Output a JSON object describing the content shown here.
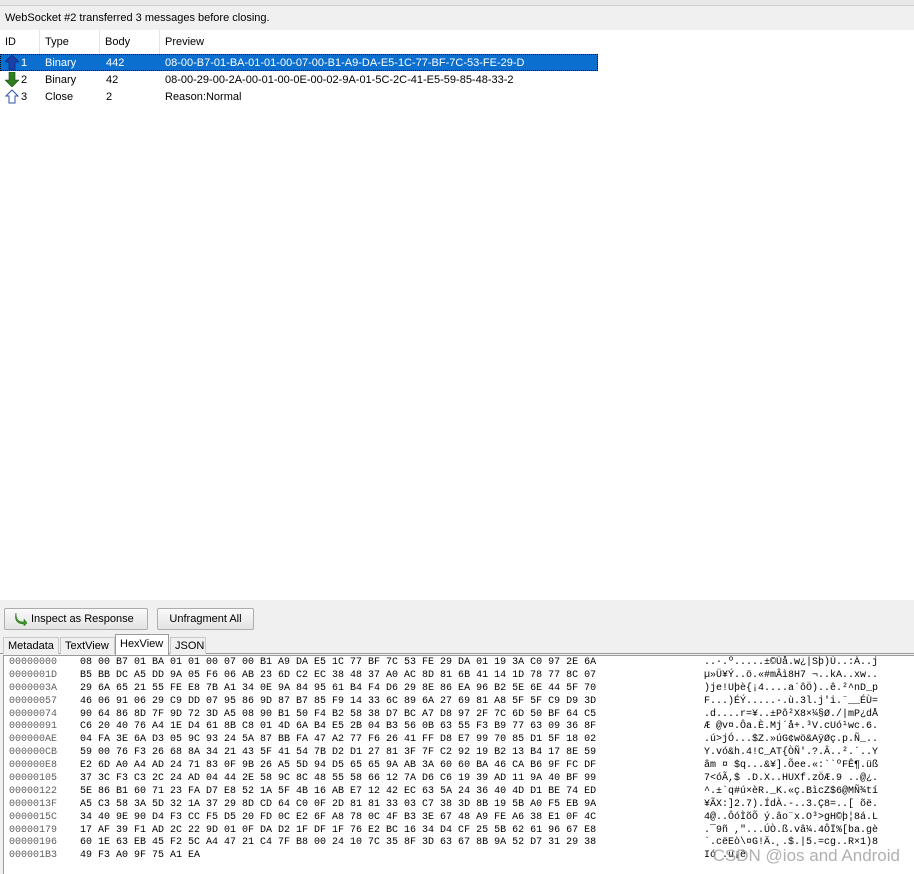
{
  "info_text": "WebSocket #2 transferred 3 messages before closing.",
  "columns": [
    "ID",
    "Type",
    "Body",
    "Preview"
  ],
  "messages": [
    {
      "id": "1",
      "type": "Binary",
      "body": "442",
      "preview": "08-00-B7-01-BA-01-01-00-07-00-B1-A9-DA-E5-1C-77-BF-7C-53-FE-29-D",
      "direction": "up-arrow-icon"
    },
    {
      "id": "2",
      "type": "Binary",
      "body": "42",
      "preview": "08-00-29-00-2A-00-01-00-0E-00-02-9A-01-5C-2C-41-E5-59-85-48-33-2",
      "direction": "down-arrow-icon"
    },
    {
      "id": "3",
      "type": "Close",
      "body": "2",
      "preview": "Reason:Normal",
      "direction": "close-arrow-icon"
    }
  ],
  "buttons": {
    "inspect": "Inspect as Response",
    "unfragment": "Unfragment All"
  },
  "tabs": [
    "Metadata",
    "TextView",
    "HexView",
    "JSON"
  ],
  "active_tab": "HexView",
  "hex_rows": [
    {
      "offset": "00000000",
      "bytes": "08 00 B7 01 BA 01 01 00 07 00 B1 A9 DA E5 1C 77 BF 7C 53 FE 29 DA 01 19 3A C0 97 2E 6A",
      "ascii": "..·.º.....±©Úå.w¿|Sþ)Ú..:À..j"
    },
    {
      "offset": "0000001D",
      "bytes": "B5 BB DC A5 DD 9A 05 F6 06 AB 23 6D C2 EC 38 48 37 A0 AC 8D 81 6B 41 14 1D 78 77 8C 07",
      "ascii": "µ»Ü¥Ý..ö.«#mÂì8H7 ¬..kA..xw.."
    },
    {
      "offset": "0000003A",
      "bytes": "29 6A 65 21 55 FE E8 7B A1 34 0E 9A 84 95 61 B4 F4 D6 29 8E 86 EA 96 B2 5E 6E 44 5F 70",
      "ascii": ")je!Uþè{¡4....a´ôÖ)..ê.²^nD_p"
    },
    {
      "offset": "00000057",
      "bytes": "46 06 91 06 29 C9 DD 07 95 86 9D 87 B7 85 F9 14 33 6C 89 6A 27 69 81 A8 5F 5F C9 D9 3D",
      "ascii": "F...)ÉÝ.....·.ù.3l.j'i.¨__ÉÙ="
    },
    {
      "offset": "00000074",
      "bytes": "90 64 86 8D 7F 9D 72 3D A5 08 90 B1 50 F4 B2 58 38 D7 BC A7 D8 97 2F 7C 6D 50 BF 64 C5",
      "ascii": ".d....r=¥..±Pô²X8×¼§Ø./|mP¿dÅ"
    },
    {
      "offset": "00000091",
      "bytes": "C6 20 40 76 A4 1E D4 61 8B C8 01 4D 6A B4 E5 2B 04 B3 56 0B 63 55 F3 B9 77 63 09 36 8F",
      "ascii": "Æ @v¤.Ôa.È.Mj´å+.³V.cUó¹wc.6."
    },
    {
      "offset": "000000AE",
      "bytes": "04 FA 3E 6A D3 05 9C 93 24 5A 87 BB FA 47 A2 77 F6 26 41 FF D8 E7 99 70 85 D1 5F 18 02",
      "ascii": ".ú>jÓ...$Z.»úG¢wö&AÿØç.p.Ñ_.."
    },
    {
      "offset": "000000CB",
      "bytes": "59 00 76 F3 26 68 8A 34 21 43 5F 41 54 7B D2 D1 27 81 3F 7F C2 92 19 B2 13 B4 17 8E 59",
      "ascii": "Y.vó&h.4!C_AT{ÒÑ'.?.Â..².´..Y"
    },
    {
      "offset": "000000E8",
      "bytes": "E2 6D A0 A4 AD 24 71 83 0F 9B 26 A5 5D 94 D5 65 65 9A AB 3A 60 60 BA 46 CA B6 9F FC DF",
      "ascii": "âm ¤ $q...&¥].Õee.«:``ºFÊ¶.üß"
    },
    {
      "offset": "00000105",
      "bytes": "37 3C F3 C3 2C 24 AD 04 44 2E 58 9C 8C 48 55 58 66 12 7A D6 C6 19 39 AD 11 9A 40 BF 99",
      "ascii": "7<óÃ,$ .D.X..HUXf.zÖÆ.9 ..@¿."
    },
    {
      "offset": "00000122",
      "bytes": "5E 86 B1 60 71 23 FA D7 E8 52 1A 5F 4B 16 AB E7 12 42 EC 63 5A 24 36 40 4D D1 BE 74 ED",
      "ascii": "^.±`q#ú×èR._K.«ç.BìcZ$6@MÑ¾tí"
    },
    {
      "offset": "0000013F",
      "bytes": "A5 C3 58 3A 5D 32 1A 37 29 8D CD 64 C0 0F 2D 81 81 33 03 C7 38 3D 8B 19 5B A0 F5 EB 9A",
      "ascii": "¥ÃX:]2.7).ÍdÀ.-..3.Ç8=..[ õë."
    },
    {
      "offset": "0000015C",
      "bytes": "34 40 9E 90 D4 F3 CC F5 D5 20 FD 0C E2 6F A8 78 0C 4F B3 3E 67 48 A9 FE A6 38 E1 0F 4C",
      "ascii": "4@..ÔóÌõÕ ý.âo¨x.O³>gH©þ¦8á.L"
    },
    {
      "offset": "00000179",
      "bytes": "17 AF 39 F1 AD 2C 22 9D 01 0F DA D2 1F DF 1F 76 E2 BC 16 34 D4 CF 25 5B 62 61 96 67 E8",
      "ascii": ".¯9ñ ,\"...ÚÒ.ß.vâ¼.4ÔÏ%[ba.gè"
    },
    {
      "offset": "00000196",
      "bytes": "60 1E 63 EB 45 F2 5C A4 47 21 C4 7F B8 00 24 10 7C 35 8F 3D 63 67 8B 9A 52 D7 31 29 38",
      "ascii": "`.cëEò\\¤G!Ä.¸.$.|5.=cg..R×1)8"
    },
    {
      "offset": "000001B3",
      "bytes": "49 F3 A0 9F 75 A1 EA",
      "ascii": "Ió .u¡ê"
    }
  ],
  "watermark": "CSDN @ios and Android"
}
